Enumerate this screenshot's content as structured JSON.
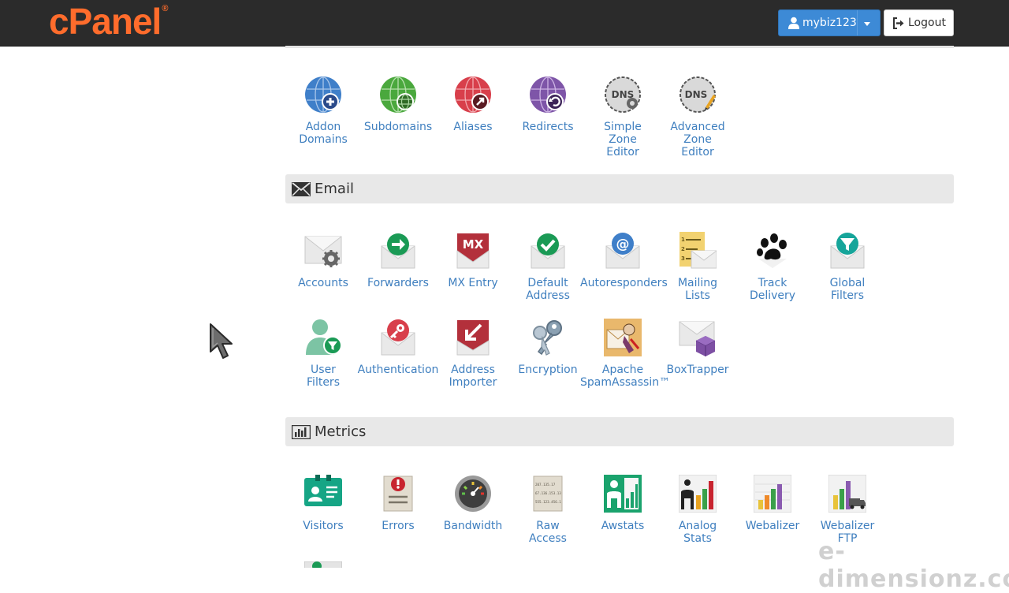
{
  "header": {
    "logo_text": "cPanel",
    "logo_mark": "®",
    "username": "mybiz123",
    "logout_label": "Logout"
  },
  "domains": {
    "items": [
      {
        "label": "Addon\nDomains",
        "icon": "globe-plus-icon"
      },
      {
        "label": "Subdomains",
        "icon": "globe-sub-icon"
      },
      {
        "label": "Aliases",
        "icon": "globe-arrow-icon"
      },
      {
        "label": "Redirects",
        "icon": "globe-redirect-icon"
      },
      {
        "label": "Simple\nZone\nEditor",
        "icon": "dns-gear-icon"
      },
      {
        "label": "Advanced\nZone\nEditor",
        "icon": "dns-pencil-icon"
      }
    ]
  },
  "email": {
    "title": "Email",
    "items": [
      {
        "label": "Accounts"
      },
      {
        "label": "Forwarders"
      },
      {
        "label": "MX Entry"
      },
      {
        "label": "Default\nAddress"
      },
      {
        "label": "Autoresponders"
      },
      {
        "label": "Mailing\nLists"
      },
      {
        "label": "Track\nDelivery"
      },
      {
        "label": "Global\nFilters"
      },
      {
        "label": "User\nFilters"
      },
      {
        "label": "Authentication"
      },
      {
        "label": "Address\nImporter"
      },
      {
        "label": "Encryption"
      },
      {
        "label": "Apache\nSpamAssassin™"
      },
      {
        "label": "BoxTrapper"
      }
    ]
  },
  "metrics": {
    "title": "Metrics",
    "items": [
      {
        "label": "Visitors"
      },
      {
        "label": "Errors"
      },
      {
        "label": "Bandwidth"
      },
      {
        "label": "Raw\nAccess"
      },
      {
        "label": "Awstats"
      },
      {
        "label": "Analog\nStats"
      },
      {
        "label": "Webalizer"
      },
      {
        "label": "Webalizer\nFTP"
      }
    ]
  },
  "raw_access_icon_text": [
    "207.135.17",
    "67.136.153.13",
    "555.123.456.1"
  ],
  "watermark": "e-dimensionz.com",
  "colors": {
    "topbar": "#2b2b2b",
    "logo": "#ff6c2c",
    "primary_button": "#3d8ad6",
    "link": "#3f7fbf",
    "section_header": "#e8e8e8"
  }
}
